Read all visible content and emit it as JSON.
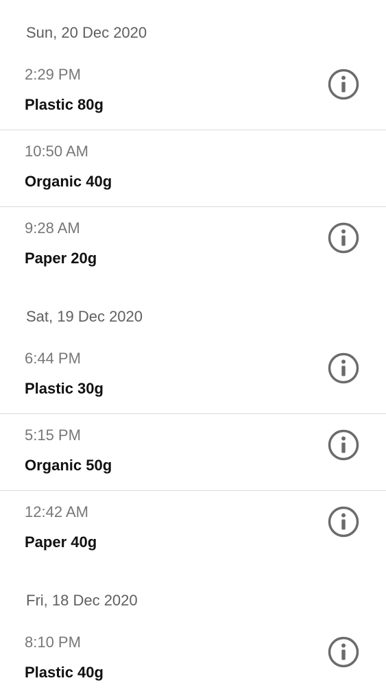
{
  "groups": [
    {
      "date": "Sun, 20 Dec 2020",
      "entries": [
        {
          "time": "2:29 PM",
          "label": "Plastic 80g",
          "info": true
        },
        {
          "time": "10:50 AM",
          "label": "Organic 40g",
          "info": false
        },
        {
          "time": "9:28 AM",
          "label": "Paper 20g",
          "info": true
        }
      ]
    },
    {
      "date": "Sat, 19 Dec 2020",
      "entries": [
        {
          "time": "6:44 PM",
          "label": "Plastic 30g",
          "info": true
        },
        {
          "time": "5:15 PM",
          "label": "Organic 50g",
          "info": true
        },
        {
          "time": "12:42 AM",
          "label": "Paper 40g",
          "info": true
        }
      ]
    },
    {
      "date": "Fri, 18 Dec 2020",
      "entries": [
        {
          "time": "8:10 PM",
          "label": "Plastic 40g",
          "info": true
        }
      ]
    }
  ],
  "icons": {
    "info": "info-icon"
  },
  "colors": {
    "icon": "#6b6b6b",
    "divider": "#d9d9d9",
    "date_text": "#5f5f5f",
    "time_text": "#777777",
    "label_text": "#111111"
  }
}
